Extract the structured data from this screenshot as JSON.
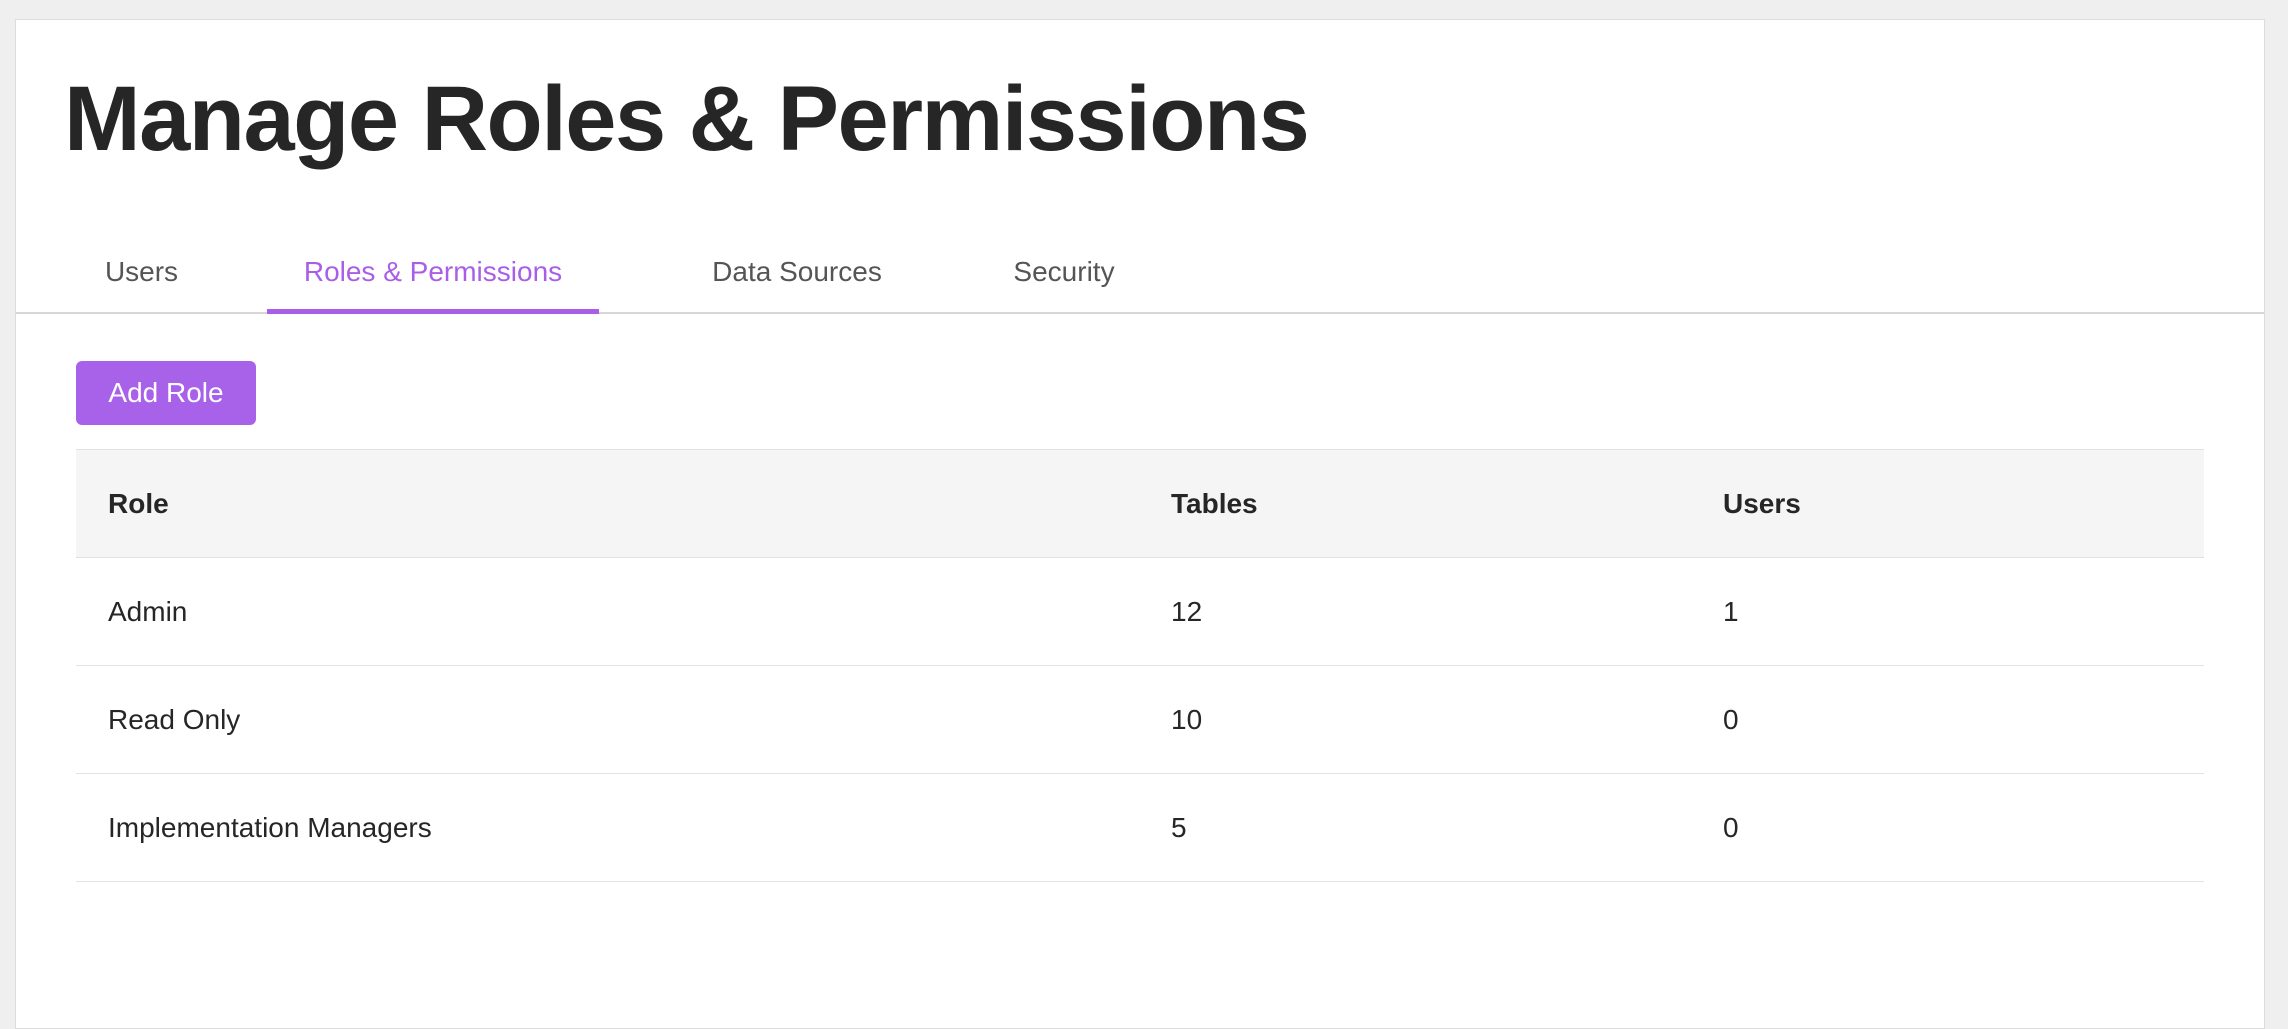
{
  "page": {
    "title": "Manage Roles & Permissions"
  },
  "tabs": [
    {
      "label": "Users",
      "active": false
    },
    {
      "label": "Roles & Permissions",
      "active": true
    },
    {
      "label": "Data Sources",
      "active": false
    },
    {
      "label": "Security",
      "active": false
    }
  ],
  "toolbar": {
    "add_role_label": "Add Role"
  },
  "table": {
    "headers": [
      "Role",
      "Tables",
      "Users"
    ],
    "rows": [
      [
        "Admin",
        "12",
        "1"
      ],
      [
        "Read Only",
        "10",
        "0"
      ],
      [
        "Implementation Managers",
        "5",
        "0"
      ]
    ]
  },
  "colors": {
    "accent": "#a862ea",
    "header_bg": "#f5f5f5",
    "title_text": "#262626"
  }
}
